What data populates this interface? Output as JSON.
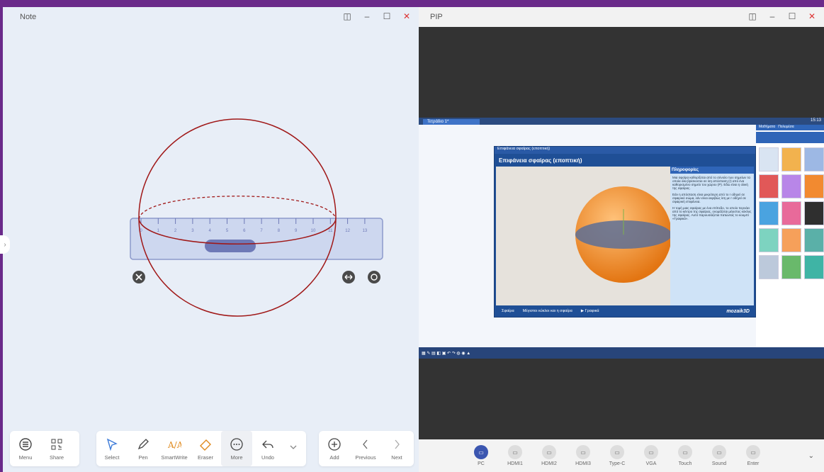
{
  "note": {
    "title": "Note",
    "ruler_ticks": [
      "0",
      "1",
      "2",
      "3",
      "4",
      "5",
      "6",
      "7",
      "8",
      "9",
      "10",
      "11",
      "12",
      "13"
    ],
    "toolbar_left": [
      {
        "label": "Menu",
        "icon": "menu-icon"
      },
      {
        "label": "Share",
        "icon": "qr-icon"
      }
    ],
    "toolbar_tools": [
      {
        "label": "Select",
        "icon": "cursor-icon"
      },
      {
        "label": "Pen",
        "icon": "pen-icon"
      },
      {
        "label": "SmartWrite",
        "icon": "smartwrite-icon"
      },
      {
        "label": "Eraser",
        "icon": "eraser-icon"
      },
      {
        "label": "More",
        "icon": "more-icon"
      },
      {
        "label": "Undo",
        "icon": "undo-icon"
      }
    ],
    "toolbar_right": [
      {
        "label": "Add",
        "icon": "add-icon"
      },
      {
        "label": "Previous",
        "icon": "chevron-left-icon"
      },
      {
        "label": "Next",
        "icon": "chevron-right-icon"
      }
    ]
  },
  "pip": {
    "title": "PIP",
    "app_tab": "Τετράδιο 1*",
    "inner_window_title": "Επιφάνεια σφαίρας (εποπτική)",
    "inner_header": "Επιφάνεια σφαίρας (εποπτική)",
    "info_title": "Πληροφορίες",
    "info_p1": "Μια σφαίρα καθορίζεται από το σύνολο των σημείων τα οποία όλα βρίσκονται σε ίση απόσταση (r) από ένα καθορισμένο σημείο του χώρου (P). Εδώ είναι η ολική της σφαίρας.",
    "info_p2": "Εάν η απόσταση είναι μικρότερη από το r οδηγεί σε σφαιρικό σώμα, εάν είναι ακριβώς ίση με r οδηγεί σε σφαιρική επιφάνεια.",
    "info_p3": "Η τομή μιας σφαίρας με ένα επίπεδο, το οποίο περνάει από το κέντρο της σφαίρας, ονομάζεται μέγιστος κύκλος της σφαίρας. Αυτό παρουσιάζεται πατώντας το κουμπί «Γραφικά».",
    "tabs": [
      "Σφαίρα",
      "Μέγιστοι κύκλοι και η σφαίρα",
      "▶ Γραφικά"
    ],
    "brand": "mozaik3D",
    "clock": "15:13",
    "side_tab1": "Μαθήματα",
    "side_tab2": "Πολυμέσα",
    "sources": [
      {
        "label": "PC",
        "active": true
      },
      {
        "label": "HDMI1",
        "active": false
      },
      {
        "label": "HDMI2",
        "active": false
      },
      {
        "label": "HDMI3",
        "active": false
      },
      {
        "label": "Type-C",
        "active": false
      },
      {
        "label": "VGA",
        "active": false
      },
      {
        "label": "Touch",
        "active": false
      },
      {
        "label": "Sound",
        "active": false
      },
      {
        "label": "Enter",
        "active": false
      }
    ]
  },
  "colors": {
    "accent": "#6a2a8a",
    "pen_red": "#a01818",
    "ruler": "#c8d3ee",
    "sphere": "#f5963a",
    "mozaik_blue": "#2f65b8"
  }
}
